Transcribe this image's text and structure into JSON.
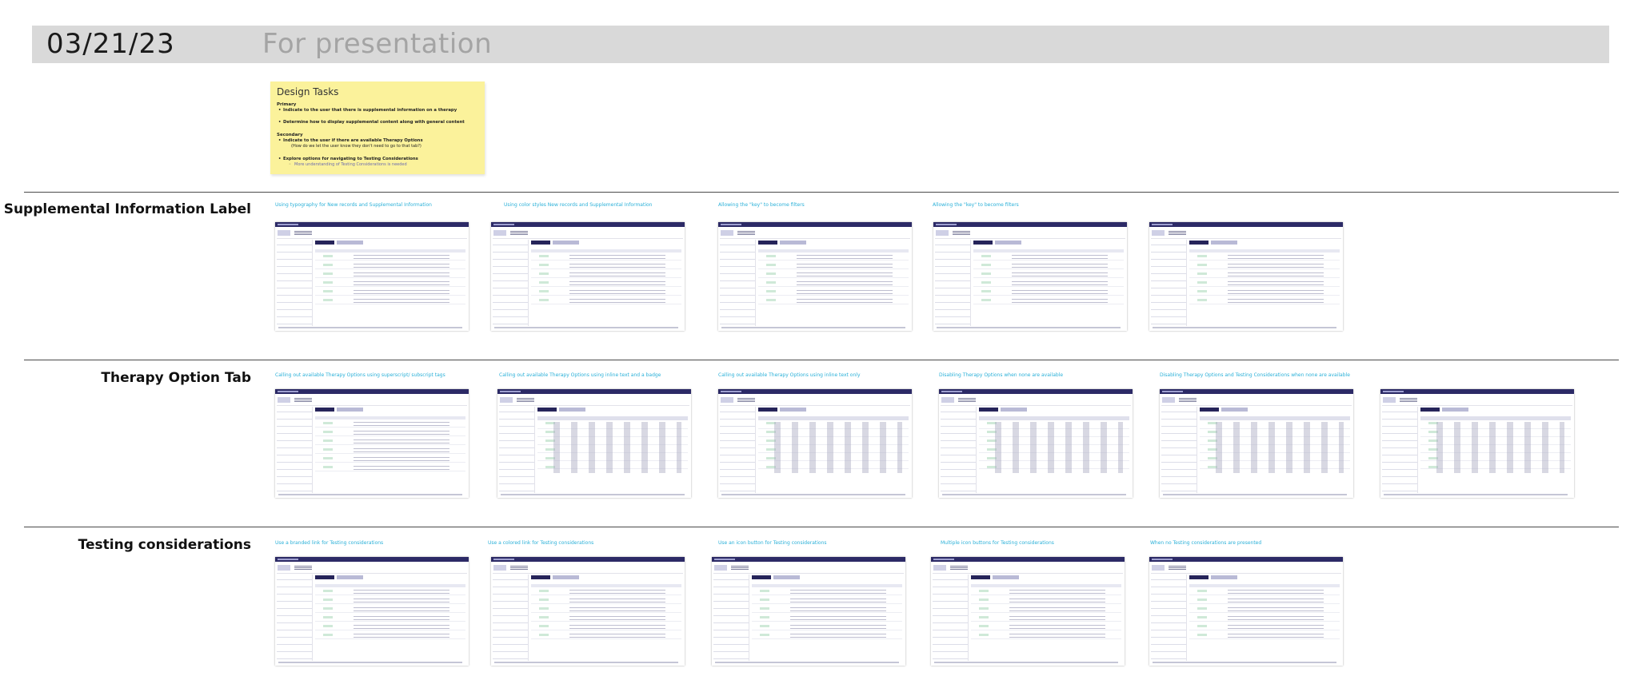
{
  "header": {
    "date": "03/21/23",
    "title": "For presentation"
  },
  "design_tasks": {
    "title": "Design Tasks",
    "primary_heading": "Primary",
    "primary_items": [
      "Indicate to the user that there is supplemental information on a therapy",
      "Determine how to display supplemental content along with general content"
    ],
    "secondary_heading": "Secondary",
    "secondary_items": [
      "Indicate to the user if there are available Therapy Options",
      "Explore options for navigating to Testing Considerations"
    ],
    "secondary_note": "(How do we let the user know they don't need to go to that tab?)",
    "secondary_subnote": "More understanding of Testing Considerations is needed"
  },
  "sections": [
    {
      "title": "Supplemental Information Label",
      "frames": [
        {
          "label": "Using typography for New records and Supplemental Information"
        },
        {
          "label": "Using color styles New records and Supplemental Information"
        },
        {
          "label": "Allowing the \"key\" to become filters"
        },
        {
          "label": "Allowing the \"key\" to become filters"
        },
        {
          "label": ""
        }
      ]
    },
    {
      "title": "Therapy Option Tab",
      "frames": [
        {
          "label": "Calling out available Therapy Options using superscript/ subscript tags"
        },
        {
          "label": "Calling out available Therapy Options using inline text and a badge"
        },
        {
          "label": "Calling out available Therapy Options using inline text only"
        },
        {
          "label": "Disabling Therapy Options when none are available"
        },
        {
          "label": "Disabling Therapy Options and Testing Considerations when none are available"
        },
        {
          "label": ""
        }
      ]
    },
    {
      "title": "Testing considerations",
      "frames": [
        {
          "label": "Use a branded link for Testing considerations"
        },
        {
          "label": "Use a colored link for Testing considerations"
        },
        {
          "label": "Use an icon button for Testing considerations"
        },
        {
          "label": "Multiple icon buttons for Testing considerations"
        },
        {
          "label": "When no Testing considerations are presented"
        }
      ]
    }
  ],
  "colors": {
    "header_band": "#d9d9d9",
    "sticky_note": "#fbf29b",
    "frame_label": "#2ab0d8",
    "app_navbar": "#2c2a66"
  }
}
